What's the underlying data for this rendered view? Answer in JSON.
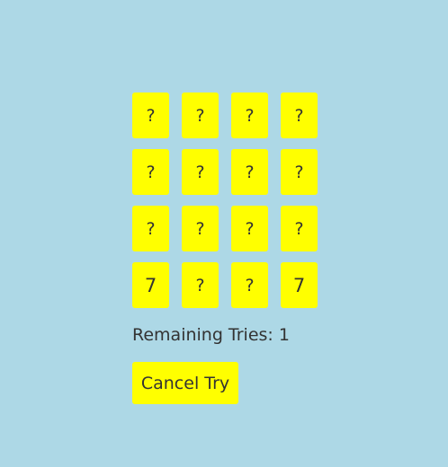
{
  "board": {
    "cards": [
      {
        "face": "?",
        "revealed": false
      },
      {
        "face": "?",
        "revealed": false
      },
      {
        "face": "?",
        "revealed": false
      },
      {
        "face": "?",
        "revealed": false
      },
      {
        "face": "?",
        "revealed": false
      },
      {
        "face": "?",
        "revealed": false
      },
      {
        "face": "?",
        "revealed": false
      },
      {
        "face": "?",
        "revealed": false
      },
      {
        "face": "?",
        "revealed": false
      },
      {
        "face": "?",
        "revealed": false
      },
      {
        "face": "?",
        "revealed": false
      },
      {
        "face": "?",
        "revealed": false
      },
      {
        "face": "7",
        "revealed": true
      },
      {
        "face": "?",
        "revealed": false
      },
      {
        "face": "?",
        "revealed": false
      },
      {
        "face": "7",
        "revealed": true
      }
    ]
  },
  "status": {
    "remaining_tries": "Remaining Tries: 1"
  },
  "actions": {
    "cancel_label": "Cancel Try"
  },
  "colors": {
    "background": "#add8e6",
    "card": "#ffff00",
    "text": "#333333"
  }
}
